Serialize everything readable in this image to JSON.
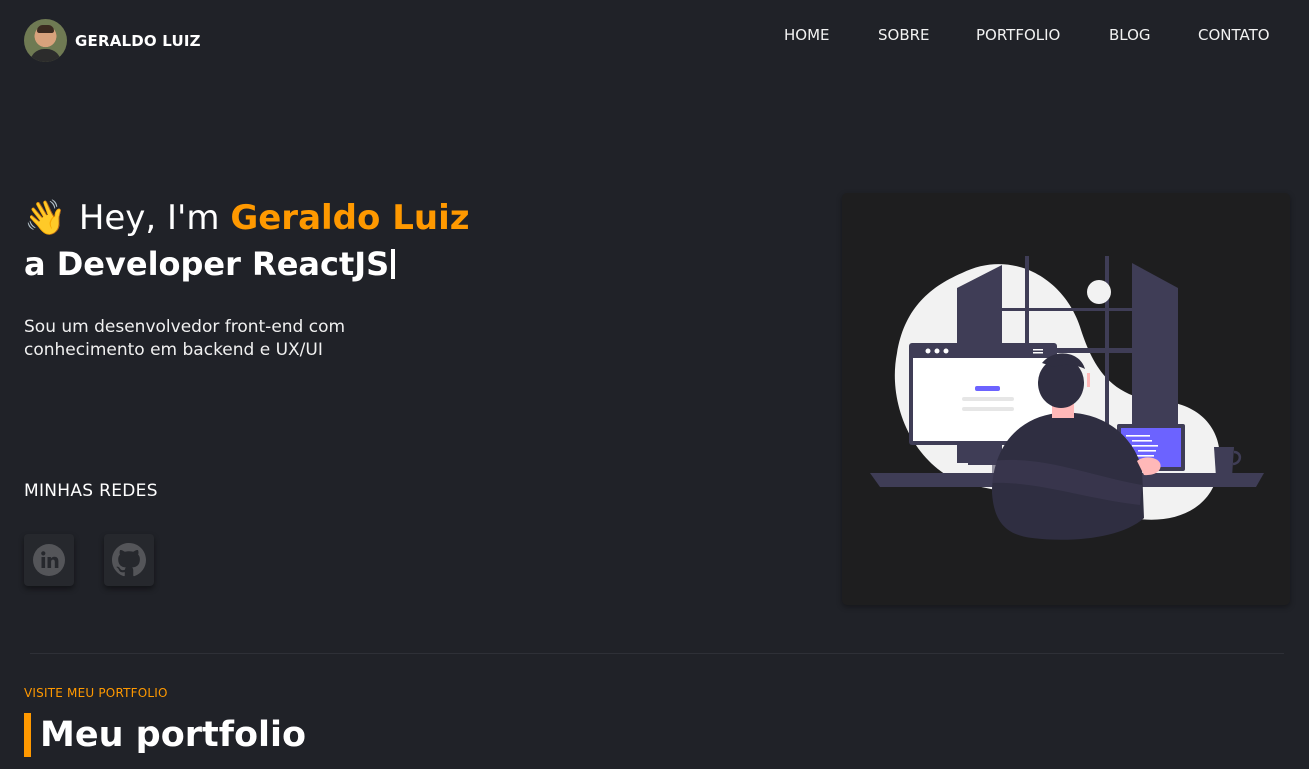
{
  "brand": {
    "name": "GERALDO LUIZ"
  },
  "nav": {
    "items": [
      {
        "label": "HOME"
      },
      {
        "label": "SOBRE"
      },
      {
        "label": "PORTFOLIO"
      },
      {
        "label": "BLOG"
      },
      {
        "label": "CONTATO"
      }
    ]
  },
  "hero": {
    "greeting": "Hey, I'm",
    "name": "Geraldo Luiz",
    "subtitle": "a Developer ReactJS",
    "description_lines": [
      "Sou um desenvolvedor front-end com",
      "conhecimento em backend e UX/UI"
    ]
  },
  "socials": {
    "label": "MINHAS REDES",
    "items": [
      {
        "icon": "linkedin-icon"
      },
      {
        "icon": "github-icon"
      }
    ]
  },
  "portfolio_section": {
    "eyebrow": "VISITE MEU PORTFOLIO",
    "title": "Meu portfolio"
  },
  "colors": {
    "background": "#202228",
    "accent": "#ff9900",
    "card": "#1e1e1f",
    "illustration_purple": "#6c63ff",
    "illustration_dark": "#3f3d56"
  }
}
